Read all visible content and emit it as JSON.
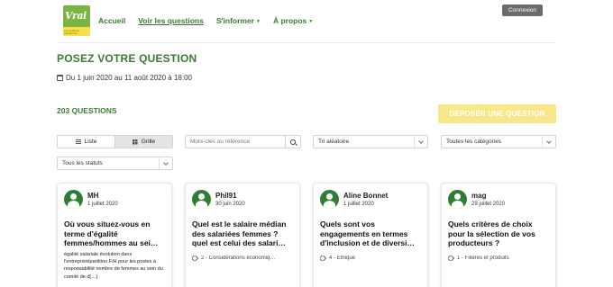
{
  "brand": {
    "logo_text": "Vrai",
    "logo_subtext": "La confiance transforme",
    "colors": {
      "green": "#3c7a34",
      "logo_green": "#7cb342",
      "logo_yellow": "#f7e14a",
      "accent_yellow": "#f7e68a"
    }
  },
  "nav": {
    "items": [
      "Accueil",
      "Voir les questions",
      "S'informer",
      "À propos"
    ],
    "active": "Voir les questions",
    "dropdown_icon": "caret-down-icon"
  },
  "header": {
    "login_label": "Connexion"
  },
  "page": {
    "title": "POSEZ VOTRE QUESTION",
    "dates": "Du 1 juin 2020 au 11 août 2020 à 18:00",
    "count_label": "203 QUESTIONS",
    "ask_button": "DÉPOSER UNE QUESTION"
  },
  "filters": {
    "view_list": "Liste",
    "view_grid": "Grille",
    "active_view": "Grille",
    "search_placeholder": "Mots-clés ou référence",
    "sort": "Tri aléatoire",
    "category": "Toutes les catégories",
    "status": "Tous les statuts"
  },
  "cards": [
    {
      "author": "MH",
      "date": "1 juillet 2020",
      "title": "Où vous situez-vous en terme d'égalité femmes/hommes au sei…",
      "excerpt": "égalité salariale évolution dans l'entreprisrépartition F/H pour les postes à responsabilité nombre de femmes au sein du comité de d[…]",
      "category": ""
    },
    {
      "author": "Phil91",
      "date": "30 juin 2020",
      "title": "Quel est le salaire médian des salariées femmes ? quel est celui des salari…",
      "excerpt": "",
      "category": "2 - Considérations économiq…"
    },
    {
      "author": "Aline Bonnet",
      "date": "1 juillet 2020",
      "title": "Quels sont vos engagements en termes d'inclusion et de diversi…",
      "excerpt": "",
      "category": "4 - Ethique"
    },
    {
      "author": "mag",
      "date": "29 juillet 2020",
      "title": "Quels critères de choix pour la sélection de vos producteurs ?",
      "excerpt": "",
      "category": "1 - Filières et produits"
    }
  ]
}
